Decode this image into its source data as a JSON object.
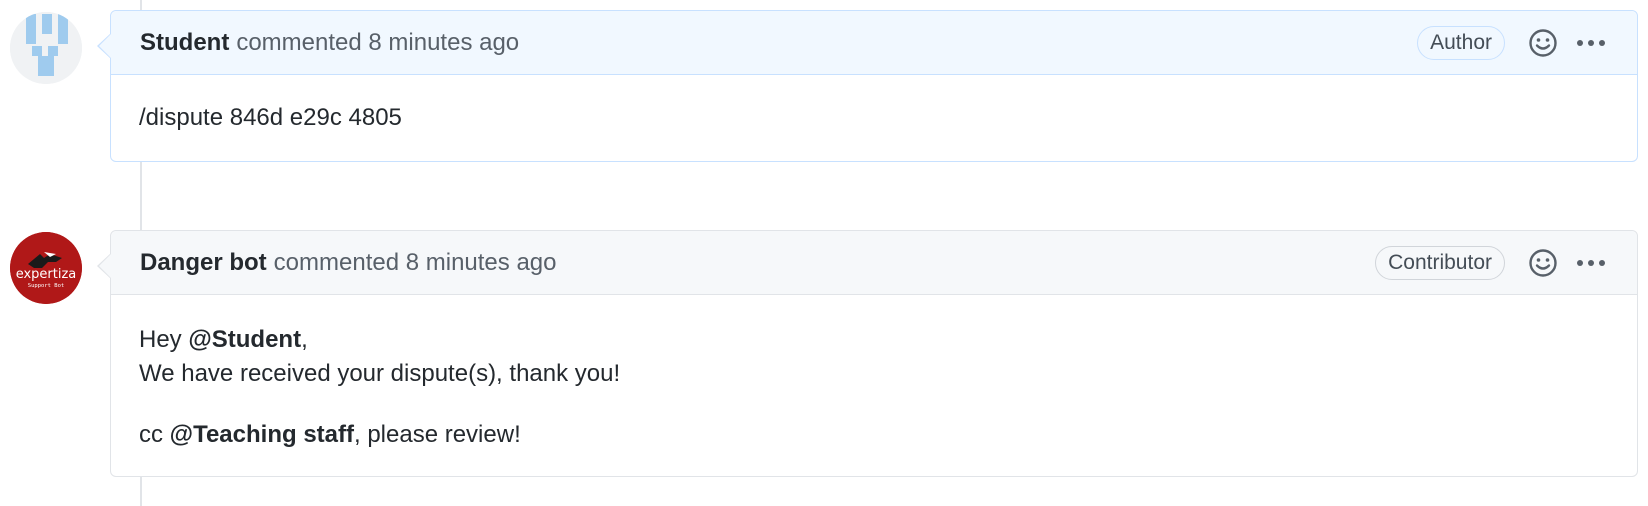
{
  "comments": [
    {
      "author": "Student",
      "meta": "commented 8 minutes ago",
      "role_badge": "Author",
      "avatar_icon": "identicon-avatar",
      "body": {
        "text": "/dispute 846d e29c 4805"
      }
    },
    {
      "author": "Danger bot",
      "meta": "commented 8 minutes ago",
      "role_badge": "Contributor",
      "avatar_icon": "bot-avatar",
      "avatar_text": "expertiza",
      "avatar_subtext": "Support Bot",
      "body": {
        "greeting_prefix": "Hey ",
        "greeting_mention": "@Student",
        "greeting_suffix": ",",
        "line2": "We have received your dispute(s), thank you!",
        "cc_prefix": "cc ",
        "cc_mention": "@Teaching staff",
        "cc_suffix": ", please review!"
      }
    }
  ],
  "colors": {
    "highlight_header": "#f1f8ff",
    "highlight_border": "#c8e1ff",
    "default_header": "#f6f8fa",
    "default_border": "#e1e4e8",
    "bot_avatar_bg": "#b01818",
    "identicon_color": "#9fcbee"
  }
}
